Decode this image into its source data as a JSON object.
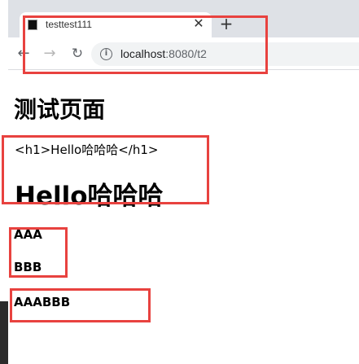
{
  "browser": {
    "tab_title": "testtest111",
    "close_glyph": "✕",
    "new_tab_glyph": "+",
    "url_host": "localhost",
    "url_rest": ":8080/t2",
    "icons": {
      "favicon": "page-favicon",
      "close": "close-icon",
      "new_tab": "plus-icon",
      "back": "arrow-left-icon",
      "forward": "arrow-right-icon",
      "reload": "reload-icon",
      "info": "info-icon"
    }
  },
  "page": {
    "title": "测试页面",
    "escaped_html": "<h1>Hello哈哈哈</h1>",
    "rendered_h1": "Hello哈哈哈",
    "line_aaa": "AAA",
    "line_bbb": "BBB",
    "line_aaabbb": "AAABBB"
  },
  "colors": {
    "annotation_border": "#e8423f",
    "tabstrip_bg": "#dee1e6",
    "omnibox_bg": "#f1f3f4"
  }
}
